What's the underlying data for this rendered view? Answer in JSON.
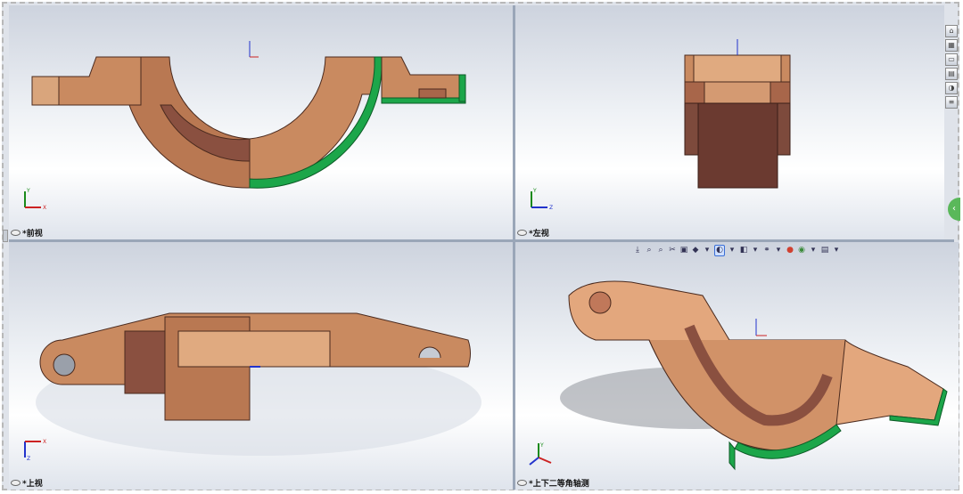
{
  "views": {
    "front": {
      "label": "*前视"
    },
    "left": {
      "label": "*左视"
    },
    "top": {
      "label": "*上视"
    },
    "iso": {
      "label": "*上下二等角轴测"
    }
  },
  "triad": {
    "x": "X",
    "y": "Y",
    "z": "Z"
  },
  "hud_icons": [
    "zoom-to-fit",
    "zoom-area",
    "previous-view",
    "section-view",
    "view-orientation",
    "display-style",
    "hide-show",
    "edit-appearance",
    "apply-scene",
    "view-setting"
  ],
  "colors": {
    "copper": "#c98a60",
    "copper_dark": "#7d4a3c",
    "section": "#1ca64a",
    "divider": "#9aa6b8"
  }
}
